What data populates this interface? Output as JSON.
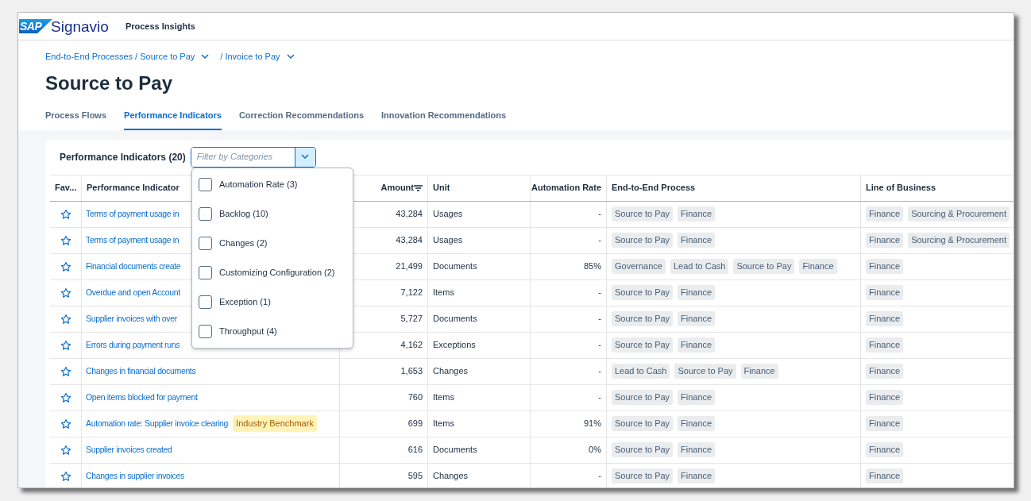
{
  "header": {
    "logo_text": "SAP",
    "brand": "Signavio",
    "product": "Process Insights"
  },
  "breadcrumbs": [
    {
      "label": "End-to-End Processes / Source to Pay",
      "menu": true
    },
    {
      "label": "/ Invoice to Pay",
      "menu": true
    }
  ],
  "title": "Source to Pay",
  "tabs": [
    {
      "label": "Process Flows",
      "selected": false
    },
    {
      "label": "Performance Indicators",
      "selected": true
    },
    {
      "label": "Correction Recommendations",
      "selected": false
    },
    {
      "label": "Innovation Recommendations",
      "selected": false
    }
  ],
  "card": {
    "title": "Performance Indicators (20)",
    "filter": {
      "placeholder": "Filter by Categories",
      "open": true
    }
  },
  "filter_options": [
    {
      "label": "Automation Rate (3)",
      "checked": false
    },
    {
      "label": "Backlog (10)",
      "checked": false
    },
    {
      "label": "Changes (2)",
      "checked": false
    },
    {
      "label": "Customizing Configuration (2)",
      "checked": false
    },
    {
      "label": "Exception (1)",
      "checked": false
    },
    {
      "label": "Throughput (4)",
      "checked": false
    }
  ],
  "table": {
    "columns": [
      {
        "label": "Fav...",
        "sorted": false
      },
      {
        "label": "Performance Indicator",
        "sorted": false
      },
      {
        "label": "Amount",
        "sorted": true
      },
      {
        "label": "Unit",
        "sorted": false
      },
      {
        "label": "Automation Rate",
        "sorted": false
      },
      {
        "label": "End-to-End Process",
        "sorted": false
      },
      {
        "label": "Line of Business",
        "sorted": false
      }
    ],
    "rows": [
      {
        "favorite": false,
        "name": "Terms of payment usage in",
        "amount": "43,284",
        "unit": "Usages",
        "automation_rate": "-",
        "processes": [
          "Source to Pay",
          "Finance"
        ],
        "lines_of_business": [
          "Finance",
          "Sourcing & Procurement"
        ]
      },
      {
        "favorite": false,
        "name": "Terms of payment usage in",
        "amount": "43,284",
        "unit": "Usages",
        "automation_rate": "-",
        "processes": [
          "Source to Pay",
          "Finance"
        ],
        "lines_of_business": [
          "Finance",
          "Sourcing & Procurement"
        ]
      },
      {
        "favorite": false,
        "name": "Financial documents create",
        "amount": "21,499",
        "unit": "Documents",
        "automation_rate": "85%",
        "processes": [
          "Governance",
          "Lead to Cash",
          "Source to Pay",
          "Finance"
        ],
        "lines_of_business": [
          "Finance"
        ]
      },
      {
        "favorite": false,
        "name": "Overdue and open Account",
        "amount": "7,122",
        "unit": "Items",
        "automation_rate": "-",
        "processes": [
          "Source to Pay",
          "Finance"
        ],
        "lines_of_business": [
          "Finance"
        ]
      },
      {
        "favorite": false,
        "name": "Supplier invoices with over",
        "amount": "5,727",
        "unit": "Documents",
        "automation_rate": "-",
        "processes": [
          "Source to Pay",
          "Finance"
        ],
        "lines_of_business": [
          "Finance"
        ]
      },
      {
        "favorite": false,
        "name": "Errors during payment runs",
        "amount": "4,162",
        "unit": "Exceptions",
        "automation_rate": "-",
        "processes": [
          "Source to Pay",
          "Finance"
        ],
        "lines_of_business": [
          "Finance"
        ]
      },
      {
        "favorite": false,
        "name": "Changes in financial documents",
        "amount": "1,653",
        "unit": "Changes",
        "automation_rate": "-",
        "processes": [
          "Lead to Cash",
          "Source to Pay",
          "Finance"
        ],
        "lines_of_business": [
          "Finance"
        ]
      },
      {
        "favorite": false,
        "name": "Open items blocked for payment",
        "amount": "760",
        "unit": "Items",
        "automation_rate": "-",
        "processes": [
          "Source to Pay",
          "Finance"
        ],
        "lines_of_business": [
          "Finance"
        ]
      },
      {
        "favorite": false,
        "name": "Automation rate: Supplier invoice clearing",
        "badge": "Industry Benchmark",
        "amount": "699",
        "unit": "Items",
        "automation_rate": "91%",
        "processes": [
          "Source to Pay",
          "Finance"
        ],
        "lines_of_business": [
          "Finance"
        ]
      },
      {
        "favorite": false,
        "name": "Supplier invoices created",
        "amount": "616",
        "unit": "Documents",
        "automation_rate": "0%",
        "processes": [
          "Source to Pay",
          "Finance"
        ],
        "lines_of_business": [
          "Finance"
        ]
      },
      {
        "favorite": false,
        "name": "Changes in supplier invoices",
        "amount": "595",
        "unit": "Changes",
        "automation_rate": "-",
        "processes": [
          "Source to Pay",
          "Finance"
        ],
        "lines_of_business": [
          "Finance"
        ]
      }
    ]
  }
}
